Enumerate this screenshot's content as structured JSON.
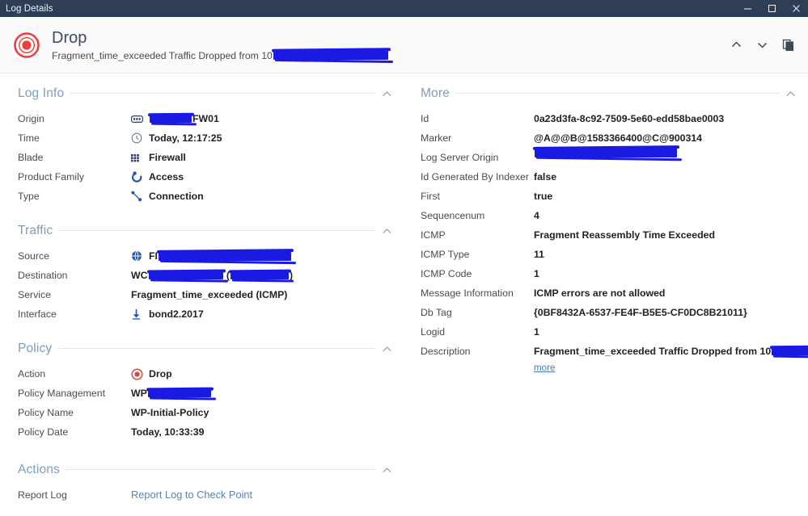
{
  "window": {
    "title": "Log Details",
    "controls": [
      {
        "name": "minimize",
        "label": "—"
      },
      {
        "name": "maximize",
        "label": "□"
      },
      {
        "name": "close",
        "label": "×"
      }
    ]
  },
  "header": {
    "icon": "drop-target-icon",
    "title": "Drop",
    "subtitle_prefix": "Fragment_time_exceeded Traffic Dropped from 10",
    "subtitle_redacted": true,
    "actions": [
      {
        "name": "previous-log-button",
        "icon": "chevron-up-icon"
      },
      {
        "name": "next-log-button",
        "icon": "chevron-down-icon"
      },
      {
        "name": "copy-button",
        "icon": "copy-icon"
      }
    ]
  },
  "accent": {
    "title_bar_bg": "#2e3e56",
    "section_title": "#7f9cbb",
    "link": "#5b83b0",
    "more_link": "#3f7fc1",
    "drop_red": "#e8413c",
    "redaction": "#1b1ae2",
    "value_text": "#222222",
    "label_text": "#4c4c4c"
  },
  "left_column": [
    {
      "id": "log-info",
      "title": "Log Info",
      "collapse_icon": "chevron-up-icon",
      "rows": [
        {
          "label": "Origin",
          "value": "FW01",
          "icon": "gateway-icon",
          "redacted": "before",
          "redact_w": 52
        },
        {
          "label": "Time",
          "value": "Today, 12:17:25",
          "icon": "clock-icon",
          "redacted": "none"
        },
        {
          "label": "Blade",
          "value": "Firewall",
          "icon": "blade-grid-icon",
          "redacted": "none"
        },
        {
          "label": "Product Family",
          "value": "Access",
          "icon": "access-icon",
          "redacted": "none"
        },
        {
          "label": "Type",
          "value": "Connection",
          "icon": "connection-icon",
          "redacted": "none"
        }
      ]
    },
    {
      "id": "traffic",
      "title": "Traffic",
      "collapse_icon": "chevron-up-icon",
      "rows": [
        {
          "label": "Source",
          "value": "FI",
          "icon": "globe-icon",
          "redacted": "after",
          "redact_w": 160
        },
        {
          "label": "Destination",
          "value": "WC",
          "icon": "none",
          "redacted": "dest",
          "redact_w": 92
        },
        {
          "label": "Service",
          "value": "Fragment_time_exceeded (ICMP)",
          "icon": "none",
          "redacted": "none"
        },
        {
          "label": "Interface",
          "value": "bond2.2017",
          "icon": "interface-icon",
          "redacted": "none"
        }
      ]
    },
    {
      "id": "policy",
      "title": "Policy",
      "collapse_icon": "chevron-up-icon",
      "rows": [
        {
          "label": "Action",
          "value": "Drop",
          "icon": "drop-target-icon",
          "redacted": "none"
        },
        {
          "label": "Policy Management",
          "value": "WP",
          "icon": "none",
          "redacted": "after",
          "redact_w": 78
        },
        {
          "label": "Policy Name",
          "value": "WP-Initial-Policy",
          "icon": "none",
          "redacted": "none"
        },
        {
          "label": "Policy Date",
          "value": "Today, 10:33:39",
          "icon": "none",
          "redacted": "none"
        }
      ]
    },
    {
      "id": "actions",
      "title": "Actions",
      "collapse_icon": "chevron-up-icon",
      "rows": [
        {
          "label": "Report Log",
          "value": "Report Log to Check Point",
          "icon": "none",
          "redacted": "none",
          "style": "link"
        }
      ]
    }
  ],
  "right_column": [
    {
      "id": "more",
      "title": "More",
      "collapse_icon": "chevron-up-icon",
      "rows": [
        {
          "label": "Id",
          "value": "0a23d3fa-8c92-7509-5e60-edd58bae0003",
          "redacted": "none"
        },
        {
          "label": "Marker",
          "value": "@A@@B@1583366400@C@900314",
          "redacted": "none"
        },
        {
          "label": "Log Server Origin",
          "value": "",
          "redacted": "full",
          "redact_w": 172
        },
        {
          "label": "Id Generated By Indexer",
          "value": "false",
          "redacted": "none"
        },
        {
          "label": "First",
          "value": "true",
          "redacted": "none"
        },
        {
          "label": "Sequencenum",
          "value": "4",
          "redacted": "none"
        },
        {
          "label": "ICMP",
          "value": "Fragment Reassembly Time Exceeded",
          "redacted": "none"
        },
        {
          "label": "ICMP Type",
          "value": "11",
          "redacted": "none"
        },
        {
          "label": "ICMP Code",
          "value": "1",
          "redacted": "none"
        },
        {
          "label": "Message Information",
          "value": "ICMP errors are not allowed",
          "redacted": "none"
        },
        {
          "label": "Db Tag",
          "value": "{0BF8432A-6537-FE4F-B5E5-CF0DC8B21011}",
          "redacted": "none"
        },
        {
          "label": "Logid",
          "value": "1",
          "redacted": "none"
        },
        {
          "label": "Description",
          "value": "Fragment_time_exceeded Traffic Dropped from 10",
          "redacted": "after",
          "redact_w": 46,
          "suffix": "..",
          "extra_link": "more"
        }
      ]
    }
  ]
}
